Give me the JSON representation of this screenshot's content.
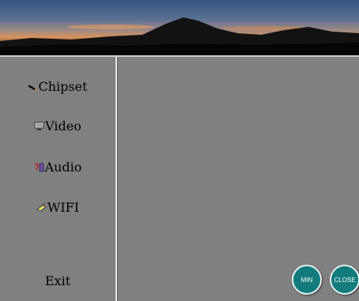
{
  "sidebar": {
    "items": [
      {
        "label": "Chipset",
        "icon": "chipset-icon"
      },
      {
        "label": "Video",
        "icon": "video-icon"
      },
      {
        "label": "Audio",
        "icon": "audio-icon"
      },
      {
        "label": "WIFI",
        "icon": "wifi-icon"
      }
    ],
    "exit_label": "Exit"
  },
  "buttons": {
    "min_label": "MIN",
    "close_label": "CLOSE"
  },
  "colors": {
    "background": "#808080",
    "button_teal": "#137b7b"
  }
}
